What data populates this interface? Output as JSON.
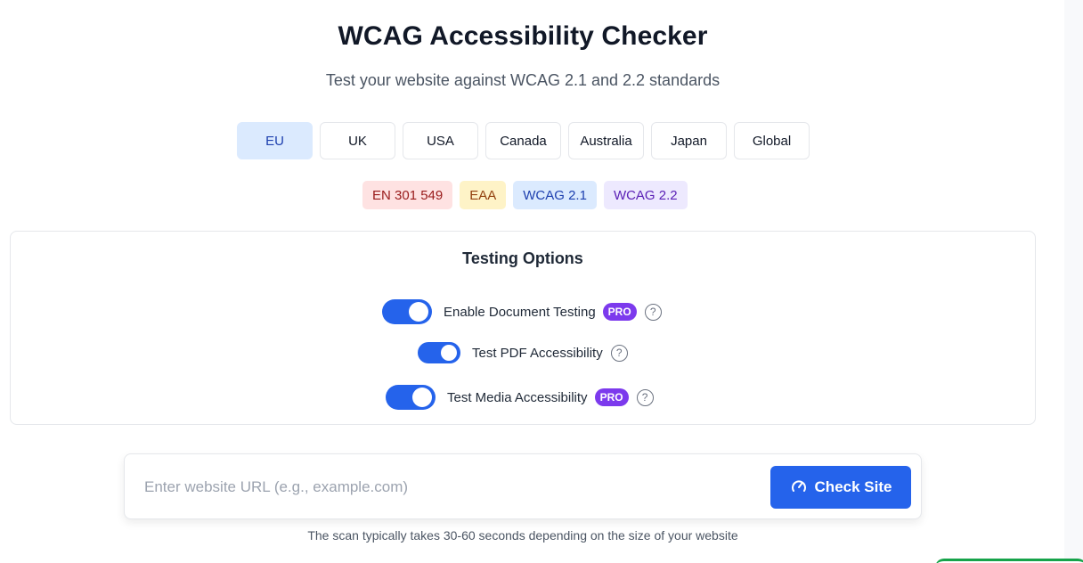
{
  "header": {
    "title": "WCAG Accessibility Checker",
    "subtitle": "Test your website against WCAG 2.1 and 2.2 standards"
  },
  "regions": [
    {
      "label": "EU",
      "selected": true
    },
    {
      "label": "UK",
      "selected": false
    },
    {
      "label": "USA",
      "selected": false
    },
    {
      "label": "Canada",
      "selected": false
    },
    {
      "label": "Australia",
      "selected": false
    },
    {
      "label": "Japan",
      "selected": false
    },
    {
      "label": "Global",
      "selected": false
    }
  ],
  "standards": [
    {
      "label": "EN 301 549",
      "color": "#fee2e2"
    },
    {
      "label": "EAA",
      "color": "#fef3c7"
    },
    {
      "label": "WCAG 2.1",
      "color": "#dbeafe"
    },
    {
      "label": "WCAG 2.2",
      "color": "#ede9fe"
    }
  ],
  "options": {
    "title": "Testing Options",
    "items": [
      {
        "label": "Enable Document Testing",
        "enabled": true,
        "pro": "PRO",
        "help_icon": "question-circle-icon"
      },
      {
        "label": "Test PDF Accessibility",
        "enabled": true,
        "help_icon": "question-circle-icon"
      },
      {
        "label": "Test Media Accessibility",
        "enabled": true,
        "pro": "PRO",
        "help_icon": "question-circle-icon"
      }
    ]
  },
  "scan": {
    "placeholder": "Enter website URL (e.g., example.com)",
    "value": "",
    "button_label": "Check Site",
    "button_icon": "gauge-icon",
    "note": "The scan typically takes 30-60 seconds depending on the size of your website"
  },
  "colors": {
    "accent": "#2563eb",
    "pro_badge": "#7c3aed",
    "selected_region_bg": "#dbeafe"
  }
}
